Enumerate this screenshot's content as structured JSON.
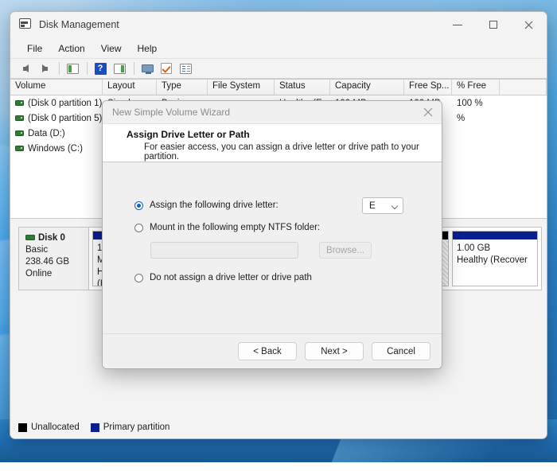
{
  "window": {
    "title": "Disk Management",
    "app_icon": "disk-management-icon",
    "controls": {
      "minimize": "minimize-icon",
      "maximize": "maximize-icon",
      "close": "close-icon"
    }
  },
  "menubar": {
    "items": [
      {
        "label": "File"
      },
      {
        "label": "Action"
      },
      {
        "label": "View"
      },
      {
        "label": "Help"
      }
    ]
  },
  "toolbar": {
    "items": [
      {
        "icon": "back-arrow-icon"
      },
      {
        "icon": "forward-arrow-icon"
      },
      {
        "icon": "show-hide-console-tree-icon"
      },
      {
        "icon": "help-icon",
        "glyph": "?"
      },
      {
        "icon": "show-hide-action-pane-icon"
      },
      {
        "icon": "rescan-disks-icon"
      },
      {
        "icon": "checkmark-icon"
      },
      {
        "icon": "properties-icon"
      }
    ]
  },
  "volume_table": {
    "columns": [
      "Volume",
      "Layout",
      "Type",
      "File System",
      "Status",
      "Capacity",
      "Free Sp...",
      "% Free"
    ],
    "rows": [
      {
        "volume": "(Disk 0 partition 1)",
        "layout": "Simple",
        "type": "Basic",
        "file_system": "",
        "status": "Healthy (E...",
        "capacity": "100 MB",
        "free_space": "100 MB",
        "percent_free": "100 %"
      },
      {
        "volume": "(Disk 0 partition 5)",
        "layout": "",
        "type": "",
        "file_system": "",
        "status": "",
        "capacity": "",
        "free_space": "",
        "percent_free": "%"
      },
      {
        "volume": "Data (D:)",
        "layout": "",
        "type": "",
        "file_system": "",
        "status": "",
        "capacity": "",
        "free_space": "",
        "percent_free": ""
      },
      {
        "volume": "Windows (C:)",
        "layout": "",
        "type": "",
        "file_system": "",
        "status": "",
        "capacity": "",
        "free_space": "",
        "percent_free": ""
      }
    ]
  },
  "disk_pane": {
    "disk": {
      "name": "Disk 0",
      "type": "Basic",
      "size": "238.46 GB",
      "status": "Online"
    },
    "partitions": [
      {
        "cap_style": "primary",
        "size": "100 MB",
        "status": "Healthy (E"
      },
      {
        "cap_style": "unalloc",
        "size": "",
        "status": ""
      },
      {
        "cap_style": "primary",
        "size": "1.00 GB",
        "status": "Healthy (Recover"
      }
    ]
  },
  "legend": {
    "items": [
      {
        "label": "Unallocated",
        "color": "#000000"
      },
      {
        "label": "Primary partition",
        "color": "#0b1f8f"
      }
    ]
  },
  "wizard": {
    "title": "New Simple Volume Wizard",
    "close_icon": "close-icon",
    "heading": "Assign Drive Letter or Path",
    "subheading": "For easier access, you can assign a drive letter or drive path to your partition.",
    "options": [
      {
        "label": "Assign the following drive letter:",
        "selected": true
      },
      {
        "label": "Mount in the following empty NTFS folder:",
        "selected": false
      },
      {
        "label": "Do not assign a drive letter or drive path",
        "selected": false
      }
    ],
    "drive_letter": "E",
    "folder_path": "",
    "folder_placeholder": "",
    "browse_label": "Browse...",
    "buttons": [
      {
        "label": "< Back"
      },
      {
        "label": "Next >"
      },
      {
        "label": "Cancel"
      }
    ]
  }
}
